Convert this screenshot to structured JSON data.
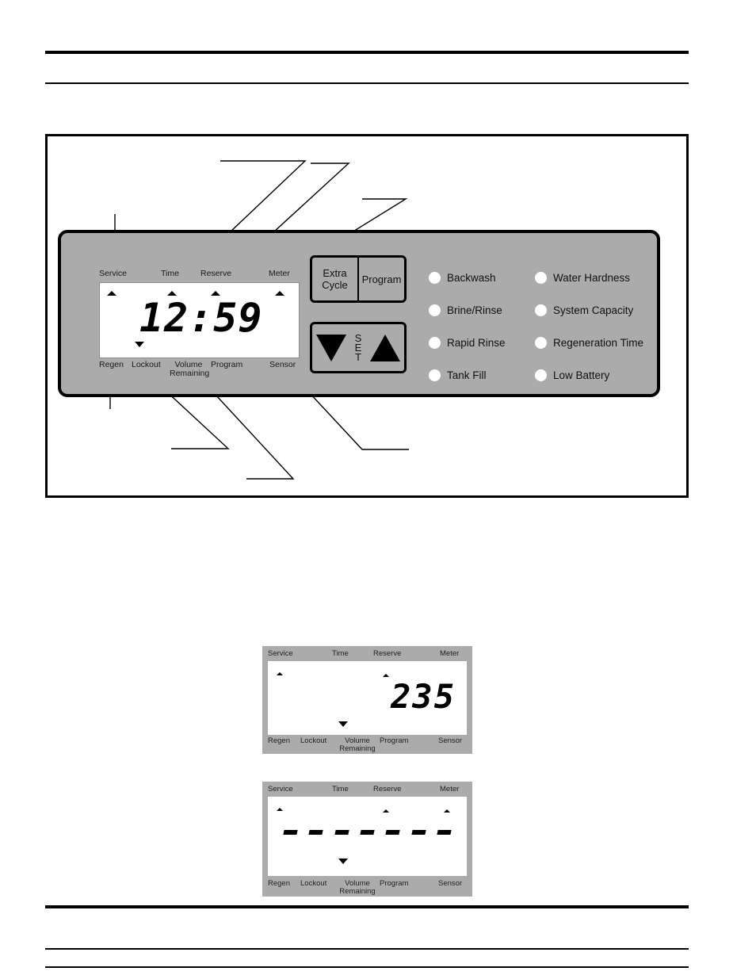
{
  "page": {
    "rules": [
      "top-thick",
      "top-thin",
      "bottom-thick",
      "bottom-thin-1",
      "bottom-thin-2"
    ]
  },
  "control_panel": {
    "lcd": {
      "top_labels": [
        "Service",
        "Time",
        "Reserve",
        "Meter"
      ],
      "bottom_labels": [
        "Regen",
        "Lockout",
        "Volume Remaining",
        "Program",
        "Sensor"
      ],
      "bottom_label_volume_line1": "Volume",
      "bottom_label_volume_line2": "Remaining",
      "display_value": "12:59",
      "up_markers": [
        "Service",
        "Time",
        "Reserve",
        "Meter"
      ],
      "down_markers": [
        "Lockout"
      ]
    },
    "buttons": {
      "extra_cycle": "Extra Cycle",
      "extra_cycle_line1": "Extra",
      "extra_cycle_line2": "Cycle",
      "program": "Program",
      "set_label": "SET",
      "set_label_s": "S",
      "set_label_e": "E",
      "set_label_t": "T",
      "down_arrow_icon": "triangle-down-icon",
      "up_arrow_icon": "triangle-up-icon"
    },
    "indicators": {
      "left_column": [
        "Backwash",
        "Brine/Rinse",
        "Rapid Rinse",
        "Tank Fill"
      ],
      "right_column": [
        "Water Hardness",
        "System Capacity",
        "Regeneration Time",
        "Low Battery"
      ]
    },
    "colors": {
      "faceplate": "#ababab",
      "lcd_background": "#ffffff",
      "led_off": "#ffffff",
      "outline": "#000000"
    }
  },
  "mini_display_1": {
    "top_labels": [
      "Service",
      "Time",
      "Reserve",
      "Meter"
    ],
    "bottom_labels": [
      "Regen",
      "Lockout",
      "Volume Remaining",
      "Program",
      "Sensor"
    ],
    "bottom_label_volume_line1": "Volume",
    "bottom_label_volume_line2": "Remaining",
    "display_value": "235",
    "up_markers": [
      "Service",
      "Reserve"
    ],
    "down_markers": [
      "Volume Remaining"
    ]
  },
  "mini_display_2": {
    "top_labels": [
      "Service",
      "Time",
      "Reserve",
      "Meter"
    ],
    "bottom_labels": [
      "Regen",
      "Lockout",
      "Volume Remaining",
      "Program",
      "Sensor"
    ],
    "bottom_label_volume_line1": "Volume",
    "bottom_label_volume_line2": "Remaining",
    "display_value": "- - - - - - -",
    "dash_count": 7,
    "up_markers": [
      "Service",
      "Reserve",
      "Meter"
    ],
    "down_markers": [
      "Volume Remaining"
    ]
  }
}
